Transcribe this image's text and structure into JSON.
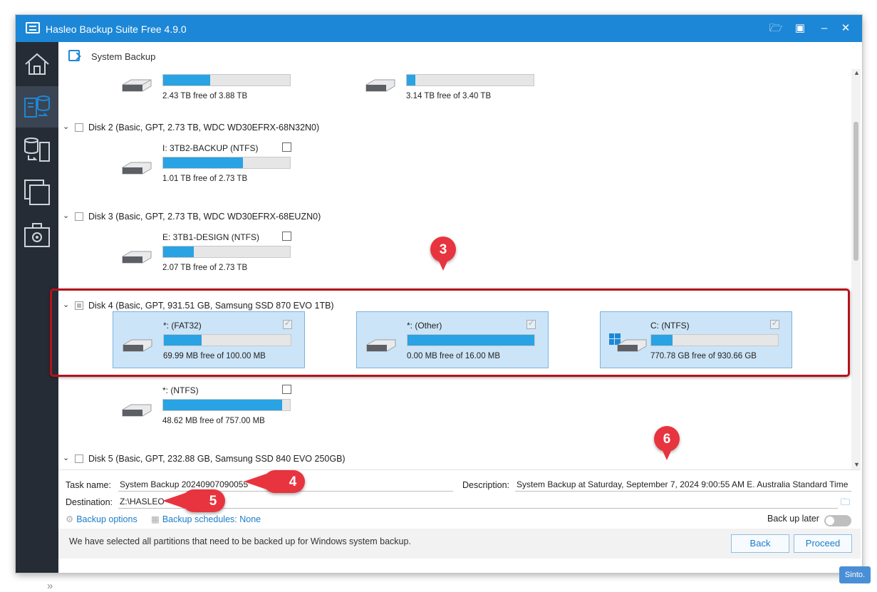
{
  "window": {
    "title": "Hasleo Backup Suite Free 4.9.0"
  },
  "header": {
    "title": "System Backup"
  },
  "sidebar": {
    "items": [
      {
        "name": "home-icon"
      },
      {
        "name": "system-backup-icon",
        "active": true
      },
      {
        "name": "restore-icon"
      },
      {
        "name": "clone-icon"
      },
      {
        "name": "tools-icon"
      }
    ]
  },
  "disks": {
    "prev_parts": [
      {
        "info": "2.43 TB free of 3.88 TB",
        "used_fraction": 0.37
      },
      {
        "info": "3.14 TB free of 3.40 TB",
        "used_fraction": 0.07
      }
    ],
    "disk2": {
      "label": "Disk 2 (Basic, GPT, 2.73 TB,  WDC WD30EFRX-68N32N0)",
      "parts": [
        {
          "name": "I: 3TB2-BACKUP (NTFS)",
          "info": "1.01 TB free of 2.73 TB",
          "used_fraction": 0.63
        }
      ]
    },
    "disk3": {
      "label": "Disk 3 (Basic, GPT, 2.73 TB,  WDC WD30EFRX-68EUZN0)",
      "parts": [
        {
          "name": "E: 3TB1-DESIGN (NTFS)",
          "info": "2.07 TB free of 2.73 TB",
          "used_fraction": 0.24
        }
      ]
    },
    "disk4": {
      "label": "Disk 4 (Basic, GPT, 931.51 GB,  Samsung SSD 870 EVO 1TB)",
      "parts": [
        {
          "name": "*: (FAT32)",
          "info": "69.99 MB free of 100.00 MB",
          "used_fraction": 0.3
        },
        {
          "name": "*: (Other)",
          "info": "0.00 MB free of 16.00 MB",
          "used_fraction": 1.0
        },
        {
          "name": "C: (NTFS)",
          "info": "770.78 GB free of 930.66 GB",
          "used_fraction": 0.17
        },
        {
          "name": "*: (NTFS)",
          "info": "48.62 MB free of 757.00 MB",
          "used_fraction": 0.94
        }
      ]
    },
    "disk5": {
      "label": "Disk 5 (Basic, GPT, 232.88 GB,  Samsung SSD 840 EVO 250GB)"
    }
  },
  "form": {
    "task_name_label": "Task name:",
    "task_name_value": "System Backup 20240907090055",
    "description_label": "Description:",
    "description_value": "System Backup at Saturday, September 7, 2024 9:00:55 AM E. Australia Standard Time",
    "destination_label": "Destination:",
    "destination_value": "Z:\\HASLEO",
    "backup_options": "Backup options",
    "backup_schedules": "Backup schedules: None",
    "back_up_later": "Back up later"
  },
  "footer": {
    "message": "We have selected all partitions that need to be backed up for Windows system backup.",
    "back": "Back",
    "proceed": "Proceed"
  },
  "annotations": [
    "3",
    "4",
    "5",
    "6"
  ],
  "watermark": "Sinto.",
  "colors": {
    "accent": "#1c87d6",
    "bar": "#29a3e3",
    "selected": "#cce4f7",
    "marker": "#e8343f",
    "highlight_box": "#b5121b"
  }
}
